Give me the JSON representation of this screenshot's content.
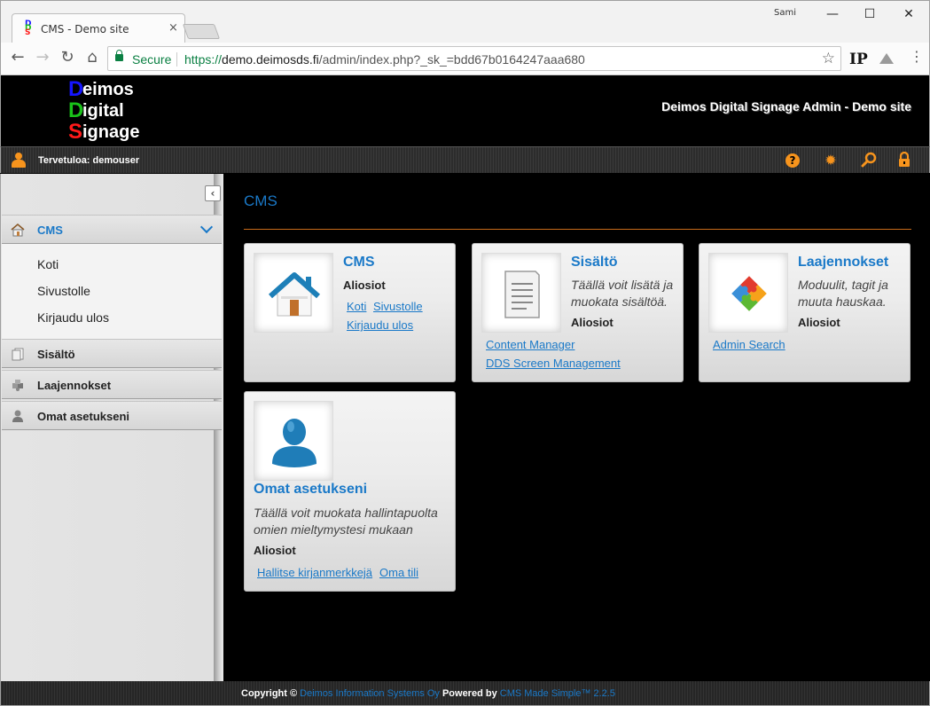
{
  "browser": {
    "tab_title": "CMS - Demo site",
    "tab_close": "×",
    "user": "Sami",
    "minimize": "—",
    "maximize": "☐",
    "close": "✕",
    "secure_label": "Secure",
    "url_scheme": "https://",
    "url_host": "demo.deimosds.fi",
    "url_path": "/admin/index.php?_sk_=bdd67b0164247aaa680",
    "ext_ip": "IP",
    "favicon_letters": [
      "D",
      "D",
      "S"
    ]
  },
  "header": {
    "logo_initials": [
      "D",
      "D",
      "S"
    ],
    "logo_words": [
      "eimos",
      "igital",
      "ignage"
    ],
    "logo_colors": [
      "#1515ff",
      "#19c219",
      "#ff1a1a"
    ],
    "site_title": "Deimos Digital Signage Admin - Demo site"
  },
  "userbar": {
    "welcome": "Tervetuloa: demouser"
  },
  "sidebar": {
    "collapse_glyph": "‹",
    "sections": [
      {
        "label": "CMS",
        "icon": "home-icon"
      },
      {
        "label": "Sisältö",
        "icon": "content-icon"
      },
      {
        "label": "Laajennokset",
        "icon": "puzzle-icon"
      },
      {
        "label": "Omat asetukseni",
        "icon": "user-icon"
      }
    ],
    "cms_items": [
      "Koti",
      "Sivustolle",
      "Kirjaudu ulos"
    ]
  },
  "main": {
    "page_title": "CMS",
    "cards": [
      {
        "title": "CMS",
        "description": "",
        "sub_label": "Aliosiot",
        "links": [
          "Koti",
          "Sivustolle",
          "Kirjaudu ulos"
        ]
      },
      {
        "title": "Sisältö",
        "description": "Täällä voit lisätä ja muokata sisältöä.",
        "sub_label": "Aliosiot",
        "links": [
          "Content Manager",
          "DDS Screen Management"
        ]
      },
      {
        "title": "Laajennokset",
        "description": "Moduulit, tagit ja muuta hauskaa.",
        "sub_label": "Aliosiot",
        "links": [
          "Admin Search"
        ]
      },
      {
        "title": "Omat asetukseni",
        "description": "Täällä voit muokata hallintapuolta omien mieltymystesi mukaan",
        "sub_label": "Aliosiot",
        "links": [
          "Hallitse kirjanmerkkejä",
          "Oma tili"
        ]
      }
    ]
  },
  "footer": {
    "copyright": "Copyright ©",
    "company": "Deimos Information Systems Oy",
    "powered_by": "Powered by",
    "cms": "CMS Made Simple™ 2.2.5"
  }
}
